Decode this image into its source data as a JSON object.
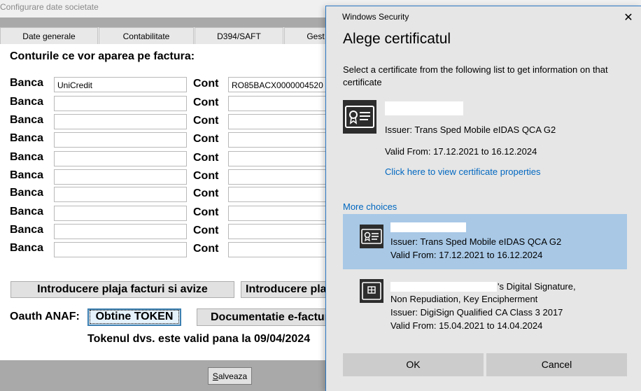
{
  "app": {
    "title": "Configurare date societate",
    "tabs": [
      "Date generale",
      "Contabilitate",
      "D394/SAFT",
      "Gest"
    ],
    "section_title": "Conturile ce vor aparea pe factura:",
    "rows": [
      {
        "bank_label": "Banca",
        "bank": "UniCredit",
        "account_label": "Cont",
        "account": "RO85BACX0000004520"
      },
      {
        "bank_label": "Banca",
        "bank": "",
        "account_label": "Cont",
        "account": ""
      },
      {
        "bank_label": "Banca",
        "bank": "",
        "account_label": "Cont",
        "account": ""
      },
      {
        "bank_label": "Banca",
        "bank": "",
        "account_label": "Cont",
        "account": ""
      },
      {
        "bank_label": "Banca",
        "bank": "",
        "account_label": "Cont",
        "account": ""
      },
      {
        "bank_label": "Banca",
        "bank": "",
        "account_label": "Cont",
        "account": ""
      },
      {
        "bank_label": "Banca",
        "bank": "",
        "account_label": "Cont",
        "account": ""
      },
      {
        "bank_label": "Banca",
        "bank": "",
        "account_label": "Cont",
        "account": ""
      },
      {
        "bank_label": "Banca",
        "bank": "",
        "account_label": "Cont",
        "account": ""
      },
      {
        "bank_label": "Banca",
        "bank": "",
        "account_label": "Cont",
        "account": ""
      }
    ],
    "invoice_range_button": "Introducere plaja facturi si avize",
    "invoice_range_button_2": "Introducere pla",
    "oauth_label": "Oauth ANAF:",
    "token_button": "Obtine TOKEN",
    "documentation_button": "Documentatie e-factur",
    "token_status": "Tokenul dvs. este valid pana la 09/04/2024",
    "save_button": "Salveaza",
    "save_accel": "S",
    "save_rest": "alveaza"
  },
  "dialog": {
    "caption": "Windows Security",
    "close_glyph": "✕",
    "heading": "Alege certificatul",
    "instruction": "Select a certificate from the following list to get information on that certificate",
    "selected_cert": {
      "issuer": "Issuer: Trans Sped Mobile eIDAS QCA G2",
      "valid": "Valid From: 17.12.2021 to 16.12.2024",
      "link": "Click here to view certificate properties"
    },
    "more_choices": "More choices",
    "choices": [
      {
        "line1": "",
        "issuer": "Issuer: Trans Sped Mobile eIDAS QCA G2",
        "valid": "Valid From: 17.12.2021 to 16.12.2024"
      },
      {
        "line1": "'s Digital Signature,",
        "line2": "Non Repudiation, Key Encipherment",
        "issuer": "Issuer: DigiSign Qualified CA Class 3 2017",
        "valid": "Valid From: 15.04.2021 to 14.04.2024"
      }
    ],
    "ok_button": "OK",
    "cancel_button": "Cancel"
  },
  "colors": {
    "selection": "#a8c8e6",
    "link": "#0067c0",
    "dialog_bg": "#e6e6e6",
    "app_band": "#a9a9a9"
  }
}
